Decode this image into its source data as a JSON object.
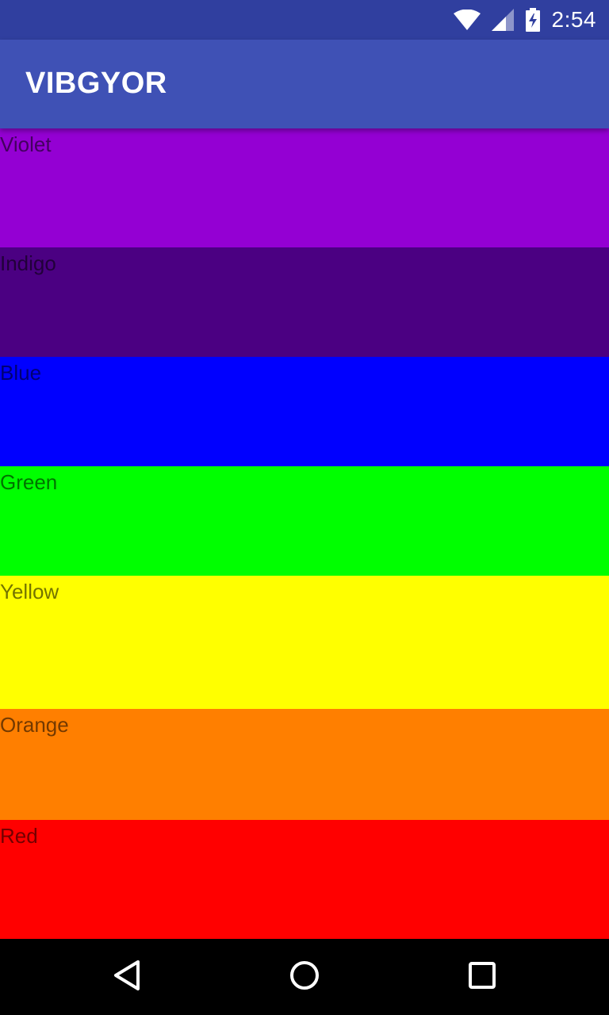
{
  "status_bar": {
    "time": "2:54",
    "icons": [
      "wifi-icon",
      "cell-signal-icon",
      "battery-charging-icon"
    ]
  },
  "app_bar": {
    "title": "VIBGYOR"
  },
  "bands": [
    {
      "label": "Violet",
      "color": "#9400d3"
    },
    {
      "label": "Indigo",
      "color": "#4b0082"
    },
    {
      "label": "Blue",
      "color": "#0000ff"
    },
    {
      "label": "Green",
      "color": "#00ff00"
    },
    {
      "label": "Yellow",
      "color": "#ffff00"
    },
    {
      "label": "Orange",
      "color": "#ff7f00"
    },
    {
      "label": "Red",
      "color": "#ff0000"
    }
  ],
  "nav_bar": {
    "icons": [
      "back-icon",
      "home-icon",
      "recents-icon"
    ]
  },
  "colors": {
    "status_bar": "#303f9f",
    "app_bar": "#3f51b5"
  }
}
